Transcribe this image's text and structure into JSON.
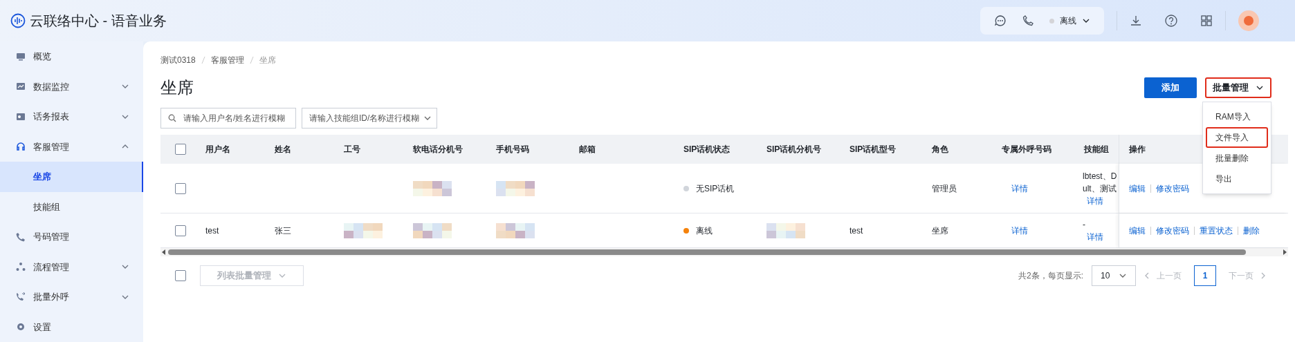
{
  "app": {
    "title": "云联络中心 - 语音业务"
  },
  "header": {
    "status": {
      "label": "离线",
      "color": "#d4d4d8"
    }
  },
  "sidebar": {
    "items": [
      {
        "label": "概览",
        "kind": "link"
      },
      {
        "label": "数据监控",
        "kind": "group",
        "expanded": false
      },
      {
        "label": "话务报表",
        "kind": "group",
        "expanded": false
      },
      {
        "label": "客服管理",
        "kind": "group",
        "expanded": true,
        "children": [
          {
            "label": "坐席",
            "selected": true
          },
          {
            "label": "技能组",
            "selected": false
          }
        ]
      },
      {
        "label": "号码管理",
        "kind": "link"
      },
      {
        "label": "流程管理",
        "kind": "group",
        "expanded": false
      },
      {
        "label": "批量外呼",
        "kind": "group",
        "expanded": false
      },
      {
        "label": "设置",
        "kind": "link"
      }
    ]
  },
  "breadcrumb": [
    "测试0318",
    "客服管理",
    "坐席"
  ],
  "page_title": "坐席",
  "filters": {
    "search": {
      "placeholder": "请输入用户名/姓名进行模糊"
    },
    "skill_select": {
      "placeholder": "请输入技能组ID/名称进行模糊"
    }
  },
  "buttons": {
    "add": "添加",
    "batch": {
      "label": "批量管理",
      "highlighted": true
    }
  },
  "batch_menu": [
    {
      "label": "RAM导入",
      "highlighted": false
    },
    {
      "label": "文件导入",
      "highlighted": true
    },
    {
      "label": "批量删除",
      "highlighted": false
    },
    {
      "label": "导出",
      "highlighted": false
    }
  ],
  "table": {
    "header_checked": false,
    "columns": [
      "用户名",
      "姓名",
      "工号",
      "软电话分机号",
      "手机号码",
      "邮箱",
      "SIP话机状态",
      "SIP话机分机号",
      "SIP话机型号",
      "角色",
      "专属外呼号码",
      "技能组",
      "操作"
    ],
    "rows": [
      {
        "checked": false,
        "cells": [
          {
            "kind": "blank"
          },
          {
            "kind": "blank"
          },
          {
            "kind": "blank"
          },
          {
            "kind": "mosaic"
          },
          {
            "kind": "mosaic"
          },
          {
            "kind": "blank"
          },
          {
            "kind": "status",
            "text": "无SIP话机",
            "color": "#d1d5db"
          },
          {
            "kind": "blank"
          },
          {
            "kind": "blank"
          },
          {
            "kind": "text",
            "text": "管理员"
          },
          {
            "kind": "link",
            "text": "详情"
          },
          {
            "kind": "skills",
            "lines": [
              "lbtest、D",
              "ult、测试"
            ],
            "link": "详情"
          }
        ],
        "actions": [
          "编辑",
          "修改密码"
        ]
      },
      {
        "checked": false,
        "cells": [
          {
            "kind": "text",
            "text": "test"
          },
          {
            "kind": "text",
            "text": "张三"
          },
          {
            "kind": "mosaic"
          },
          {
            "kind": "mosaic"
          },
          {
            "kind": "mosaic"
          },
          {
            "kind": "blank"
          },
          {
            "kind": "status",
            "text": "离线",
            "color": "#f5820b"
          },
          {
            "kind": "mosaic"
          },
          {
            "kind": "text",
            "text": "test"
          },
          {
            "kind": "text",
            "text": "坐席"
          },
          {
            "kind": "link",
            "text": "详情"
          },
          {
            "kind": "skills",
            "lines": [
              "-"
            ],
            "link": "详情"
          }
        ],
        "actions": [
          "编辑",
          "修改密码",
          "重置状态",
          "删除"
        ]
      }
    ]
  },
  "footer": {
    "checked": false,
    "bulk_button": {
      "label": "列表批量管理",
      "disabled": true
    },
    "total": "共2条，每页显示:",
    "page_size": "10",
    "prev": {
      "label": "上一页",
      "disabled": true
    },
    "pages": [
      {
        "label": "1",
        "selected": true
      }
    ],
    "next": {
      "label": "下一页",
      "disabled": true
    }
  }
}
